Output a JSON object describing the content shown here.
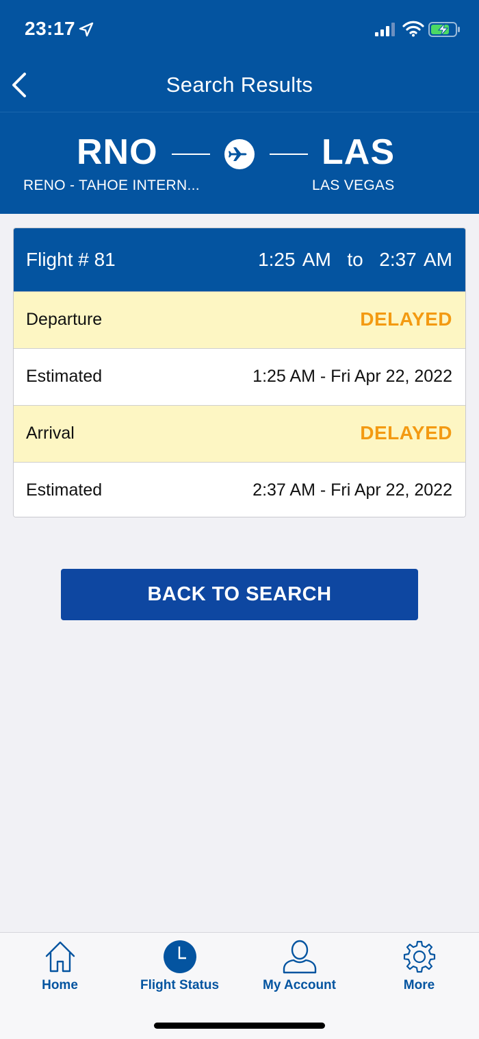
{
  "status_bar": {
    "time": "23:17"
  },
  "nav": {
    "title": "Search Results"
  },
  "route": {
    "origin_code": "RNO",
    "origin_name": "RENO - TAHOE INTERN...",
    "dest_code": "LAS",
    "dest_name": "LAS VEGAS"
  },
  "flight": {
    "number_label": "Flight # 81",
    "times": "1:25 AM  to  2:37 AM",
    "departure": {
      "label": "Departure",
      "status": "DELAYED",
      "estimated_label": "Estimated",
      "estimated_value": "1:25 AM - Fri Apr 22, 2022"
    },
    "arrival": {
      "label": "Arrival",
      "status": "DELAYED",
      "estimated_label": "Estimated",
      "estimated_value": "2:37 AM - Fri Apr 22, 2022"
    }
  },
  "back_button": {
    "label": "BACK TO SEARCH"
  },
  "tabs": [
    {
      "label": "Home",
      "icon": "home-icon"
    },
    {
      "label": "Flight Status",
      "icon": "clock-icon"
    },
    {
      "label": "My Account",
      "icon": "user-icon"
    },
    {
      "label": "More",
      "icon": "gear-icon"
    }
  ],
  "colors": {
    "brand_blue": "#0454a0",
    "button_blue": "#0e47a1",
    "delayed_orange": "#f39a12",
    "status_row_bg": "#fdf6c3",
    "battery_green": "#4cd964"
  }
}
